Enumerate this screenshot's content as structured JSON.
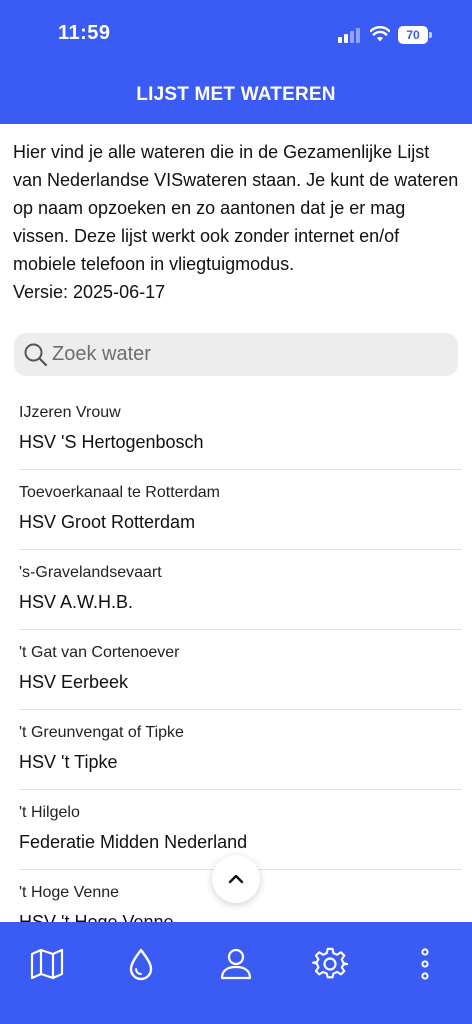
{
  "status_bar": {
    "time": "11:59",
    "battery": "70"
  },
  "header": {
    "title": "LIJST MET WATEREN"
  },
  "intro": "Hier vind je alle wateren die in de Gezamenlijke Lijst van Nederlandse VISwateren staan. Je kunt de wateren op naam opzoeken en zo aantonen dat je er mag vissen. Deze lijst werkt ook zonder internet en/of mobiele telefoon in vliegtuigmodus.",
  "version": "Versie: 2025-06-17",
  "search": {
    "placeholder": "Zoek water",
    "value": ""
  },
  "waters": [
    {
      "name": "IJzeren Vrouw",
      "owner": "HSV 'S Hertogenbosch"
    },
    {
      "name": "Toevoerkanaal te Rotterdam",
      "owner": "HSV Groot Rotterdam"
    },
    {
      "name": "'s-Gravelandsevaart",
      "owner": "HSV A.W.H.B."
    },
    {
      "name": "'t Gat van Cortenoever",
      "owner": "HSV Eerbeek"
    },
    {
      "name": "'t Greunvengat of Tipke",
      "owner": "HSV 't Tipke"
    },
    {
      "name": "'t Hilgelo",
      "owner": "Federatie Midden Nederland"
    },
    {
      "name": "'t Hoge Venne",
      "owner": "HSV 't Hoge Venne"
    }
  ],
  "tabs": [
    {
      "icon": "map-icon"
    },
    {
      "icon": "water-drop-icon",
      "active": true
    },
    {
      "icon": "user-icon"
    },
    {
      "icon": "settings-icon"
    },
    {
      "icon": "more-vertical-icon"
    }
  ],
  "colors": {
    "accent": "#3b5bf5",
    "search_bg": "#ededed",
    "divider": "#e2e2e2"
  }
}
